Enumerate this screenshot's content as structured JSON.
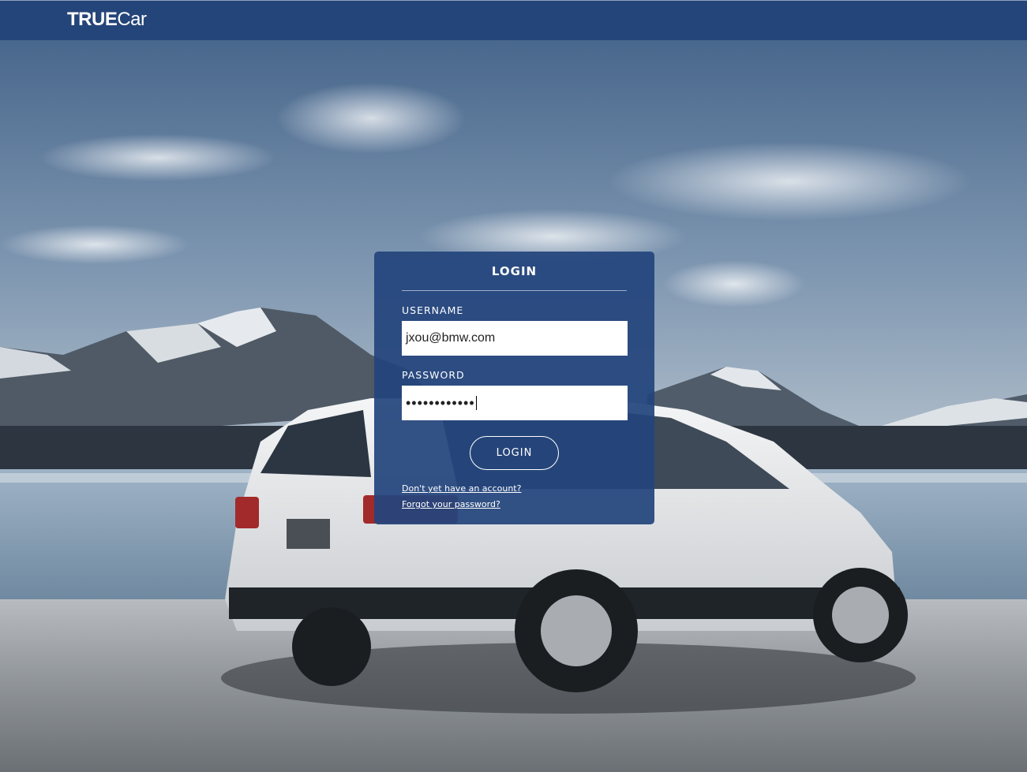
{
  "header": {
    "logo_bold": "TRUE",
    "logo_light": "Car"
  },
  "login": {
    "title": "LOGIN",
    "username_label": "USERNAME",
    "username_value": "jxou@bmw.com",
    "password_label": "PASSWORD",
    "password_mask": "••••••••••••",
    "submit_label": "LOGIN",
    "signup_link": "Don't yet have an account?",
    "forgot_link": "Forgot your password?"
  },
  "colors": {
    "header_bg": "#244579",
    "card_bg": "#24457d",
    "text": "#ffffff"
  }
}
